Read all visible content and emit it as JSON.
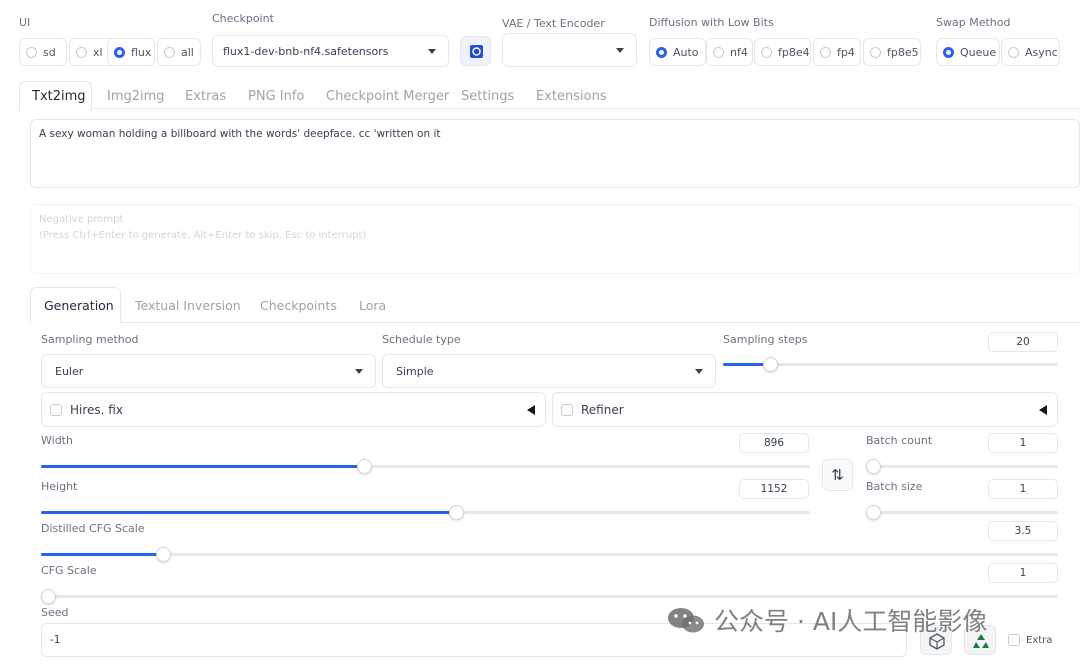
{
  "top": {
    "ui_label": "UI",
    "ui_options": [
      {
        "label": "sd",
        "selected": false
      },
      {
        "label": "xl",
        "selected": false
      },
      {
        "label": "flux",
        "selected": true
      },
      {
        "label": "all",
        "selected": false
      }
    ],
    "checkpoint_label": "Checkpoint",
    "checkpoint_value": "flux1-dev-bnb-nf4.safetensors",
    "vae_label": "VAE / Text Encoder",
    "vae_value": "",
    "diffusion_label": "Diffusion with Low Bits",
    "diffusion_options": [
      {
        "label": "Auto",
        "selected": true
      },
      {
        "label": "nf4",
        "selected": false
      },
      {
        "label": "fp8e4",
        "selected": false
      },
      {
        "label": "fp4",
        "selected": false
      },
      {
        "label": "fp8e5",
        "selected": false
      }
    ],
    "swap_label": "Swap Method",
    "swap_options": [
      {
        "label": "Queue",
        "selected": true
      },
      {
        "label": "Async",
        "selected": false
      }
    ]
  },
  "tabs": [
    "Txt2img",
    "Img2img",
    "Extras",
    "PNG Info",
    "Checkpoint Merger",
    "Settings",
    "Extensions"
  ],
  "prompt": "A sexy woman holding a billboard with the words' deepface. cc 'written on it",
  "negative_prompt": {
    "placeholder_line1": "Negative prompt",
    "placeholder_line2": "(Press Ctrl+Enter to generate, Alt+Enter to skip, Esc to interrupt)"
  },
  "subtabs": [
    "Generation",
    "Textual Inversion",
    "Checkpoints",
    "Lora"
  ],
  "generation": {
    "sampling_method_label": "Sampling method",
    "sampling_method_value": "Euler",
    "schedule_type_label": "Schedule type",
    "schedule_type_value": "Simple",
    "sampling_steps_label": "Sampling steps",
    "sampling_steps_value": "20",
    "hires_label": "Hires. fix",
    "refiner_label": "Refiner",
    "width_label": "Width",
    "width_value": "896",
    "height_label": "Height",
    "height_value": "1152",
    "batch_count_label": "Batch count",
    "batch_count_value": "1",
    "batch_size_label": "Batch size",
    "batch_size_value": "1",
    "distilled_cfg_label": "Distilled CFG Scale",
    "distilled_cfg_value": "3.5",
    "cfg_label": "CFG Scale",
    "cfg_value": "1",
    "seed_label": "Seed",
    "seed_value": "-1",
    "extra_label": "Extra",
    "swap_glyph": "⇅"
  },
  "sliders": {
    "sampling_steps_fraction": 0.14,
    "width_fraction": 0.42,
    "height_fraction": 0.54,
    "batch_count_fraction": 0.0,
    "batch_size_fraction": 0.0,
    "distilled_cfg_fraction": 0.12,
    "cfg_fraction": 0.0
  },
  "watermark": "公众号 · AI人工智能影像",
  "colors": {
    "accent": "#2563eb",
    "border": "#e5e7eb",
    "muted_text": "#9ca3af"
  }
}
